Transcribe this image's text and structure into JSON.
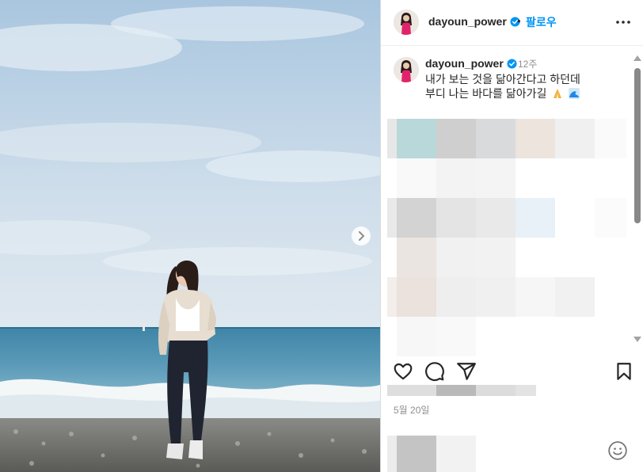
{
  "post": {
    "username": "dayoun_power",
    "follow_label": "팔로우",
    "dot": "•",
    "more_icon": "more-horizontal-icon"
  },
  "caption": {
    "username": "dayoun_power",
    "time": "12주",
    "line1": "내가 보는 것을 닮아간다고 하던데",
    "line2": "부디 나는 바다를 닮아가길"
  },
  "footer": {
    "date": "5월 20일"
  },
  "colors": {
    "verified": "#0095f6",
    "follow": "#0095f6",
    "text": "#262626",
    "muted": "#8e8e8e"
  },
  "icons": [
    "heart-icon",
    "comment-icon",
    "share-icon",
    "bookmark-icon",
    "smile-icon",
    "chevron-right-icon"
  ]
}
